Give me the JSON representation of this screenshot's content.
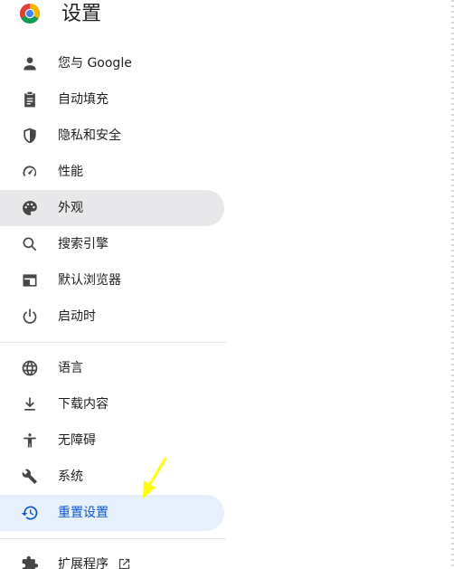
{
  "header": {
    "title": "设置"
  },
  "nav": {
    "items": [
      {
        "label": "您与 Google",
        "icon": "person-icon"
      },
      {
        "label": "自动填充",
        "icon": "clipboard-icon"
      },
      {
        "label": "隐私和安全",
        "icon": "shield-icon"
      },
      {
        "label": "性能",
        "icon": "speedometer-icon"
      },
      {
        "label": "外观",
        "icon": "palette-icon"
      },
      {
        "label": "搜索引擎",
        "icon": "search-icon"
      },
      {
        "label": "默认浏览器",
        "icon": "browser-window-icon"
      },
      {
        "label": "启动时",
        "icon": "power-icon"
      },
      {
        "label": "语言",
        "icon": "globe-icon"
      },
      {
        "label": "下载内容",
        "icon": "download-icon"
      },
      {
        "label": "无障碍",
        "icon": "accessibility-icon"
      },
      {
        "label": "系统",
        "icon": "wrench-icon"
      },
      {
        "label": "重置设置",
        "icon": "history-reset-icon"
      },
      {
        "label": "扩展程序",
        "icon": "puzzle-icon"
      }
    ]
  },
  "colors": {
    "selected_bg": "#e8e8ea",
    "active_bg": "#e7f0fd",
    "active_text": "#0b57d0",
    "annotation_arrow": "#ffff00"
  }
}
